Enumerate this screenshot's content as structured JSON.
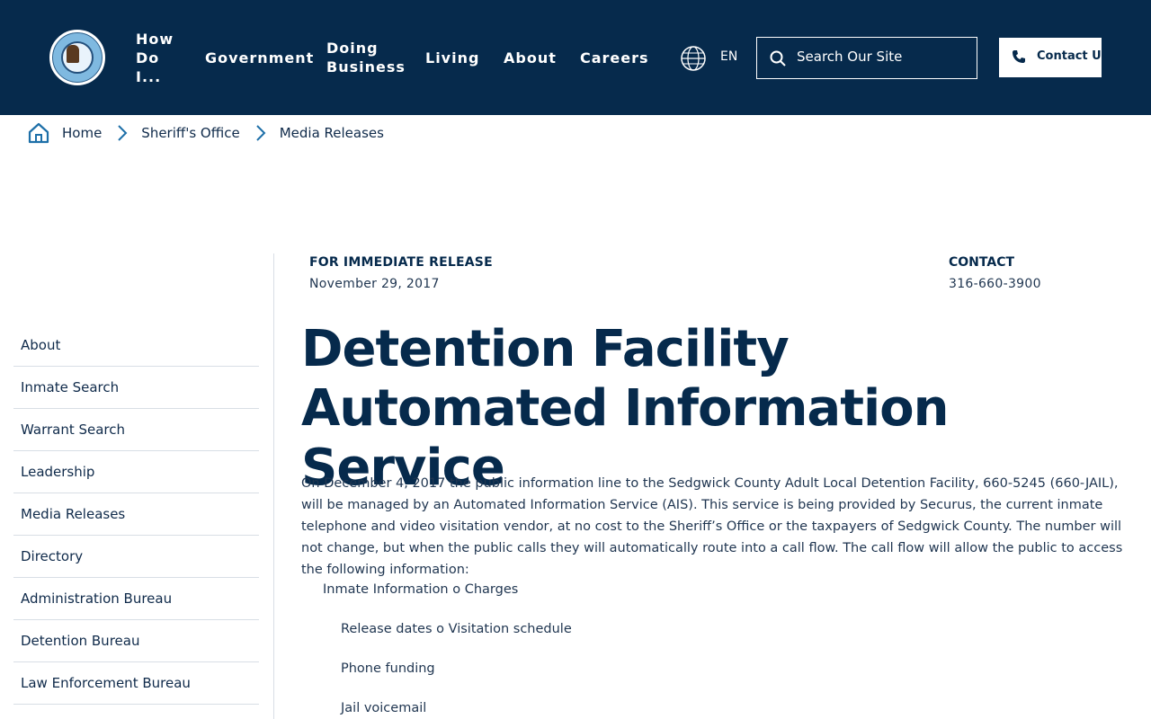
{
  "header": {
    "nav": [
      {
        "label": "How Do I..."
      },
      {
        "label": "Government"
      },
      {
        "label": "Doing Business"
      },
      {
        "label": "Living"
      },
      {
        "label": "About"
      },
      {
        "label": "Careers"
      }
    ],
    "language": "EN",
    "search_placeholder": "Search Our Site",
    "contact_label": "Contact Us",
    "brand_color": "#062a4c"
  },
  "breadcrumb": {
    "items": [
      "Home",
      "Sheriff's Office",
      "Media Releases"
    ]
  },
  "sidebar": {
    "items": [
      "About",
      "Inmate Search",
      "Warrant Search",
      "Leadership",
      "Media Releases",
      "Directory",
      "Administration Bureau",
      "Detention Bureau",
      "Law Enforcement Bureau"
    ]
  },
  "release": {
    "heading": "FOR IMMEDIATE RELEASE",
    "date": "November 29, 2017",
    "contact_heading": "CONTACT",
    "contact_phone": "316-660-3900",
    "title": "Detention Facility Automated Information Service",
    "body": "On December 4, 2017 the public information line to the Sedgwick County Adult Local Detention Facility, 660-5245 (660-JAIL), will be managed by an Automated Information Service (AIS). This service is being provided by Securus, the current inmate telephone and video visitation vendor, at no cost to the Sheriff’s Office or the taxpayers of Sedgwick County. The number will not change, but when the public calls they will automatically route into a call flow. The call flow will allow the public to access the following information:",
    "list": [
      {
        "level": 1,
        "text": "Inmate Information o Charges"
      },
      {
        "level": 2,
        "text": "Release dates o Visitation schedule"
      },
      {
        "level": 2,
        "text": "Phone funding"
      },
      {
        "level": 2,
        "text": "Jail voicemail"
      }
    ]
  }
}
